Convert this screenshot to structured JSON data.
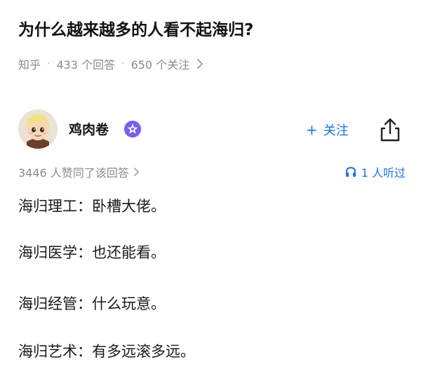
{
  "question": {
    "title": "为什么越来越多的人看不起海归?"
  },
  "meta": {
    "source": "知乎",
    "answers": "433 个回答",
    "followers": "650 个关注"
  },
  "author": {
    "name": "鸡肉卷",
    "follow_label": "关注"
  },
  "stats": {
    "upvotes": "3446 人赞同了该回答",
    "listeners": "1 人听过"
  },
  "answer": {
    "lines": [
      "海归理工：卧槽大佬。",
      "海归医学：也还能看。",
      "海归经管：什么玩意。",
      "海归艺术：有多远滚多远。"
    ]
  },
  "colors": {
    "accent": "#1772f6",
    "meta_gray": "#8a8a8a",
    "text": "#1a1a1a"
  },
  "icons": {
    "chevron": "chevron-right-icon",
    "badge": "creator-badge-icon",
    "share": "share-icon",
    "headphones": "headphones-icon"
  }
}
